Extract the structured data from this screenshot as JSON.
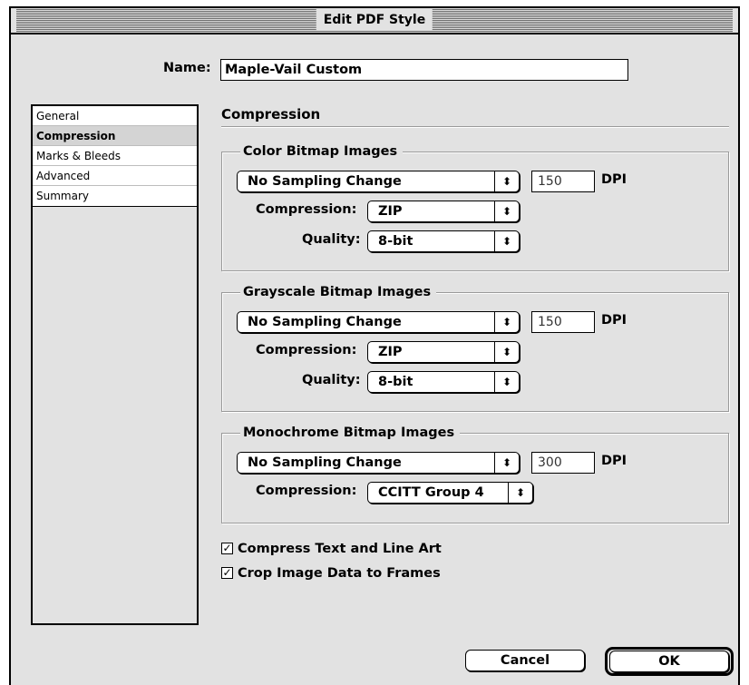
{
  "window": {
    "title": "Edit PDF Style"
  },
  "name": {
    "label": "Name:",
    "value": "Maple-Vail Custom"
  },
  "sidebar": {
    "items": [
      {
        "label": "General",
        "selected": false
      },
      {
        "label": "Compression",
        "selected": true
      },
      {
        "label": "Marks & Bleeds",
        "selected": false
      },
      {
        "label": "Advanced",
        "selected": false
      },
      {
        "label": "Summary",
        "selected": false
      }
    ]
  },
  "section": {
    "heading": "Compression"
  },
  "groups": {
    "color": {
      "title": "Color Bitmap Images",
      "sampling": "No Sampling Change",
      "dpi": "150",
      "dpi_unit": "DPI",
      "compression_label": "Compression:",
      "compression": "ZIP",
      "quality_label": "Quality:",
      "quality": "8-bit"
    },
    "grayscale": {
      "title": "Grayscale Bitmap Images",
      "sampling": "No Sampling Change",
      "dpi": "150",
      "dpi_unit": "DPI",
      "compression_label": "Compression:",
      "compression": "ZIP",
      "quality_label": "Quality:",
      "quality": "8-bit"
    },
    "monochrome": {
      "title": "Monochrome Bitmap Images",
      "sampling": "No Sampling Change",
      "dpi": "300",
      "dpi_unit": "DPI",
      "compression_label": "Compression:",
      "compression": "CCITT Group 4"
    }
  },
  "options": {
    "compress_text": {
      "label": "Compress Text and Line Art",
      "checked": true
    },
    "crop_image": {
      "label": "Crop Image Data to Frames",
      "checked": true
    }
  },
  "buttons": {
    "cancel": "Cancel",
    "ok": "OK"
  },
  "icons": {
    "popup_arrows": "updown-arrows-icon",
    "checkmark": "checkmark-icon"
  }
}
